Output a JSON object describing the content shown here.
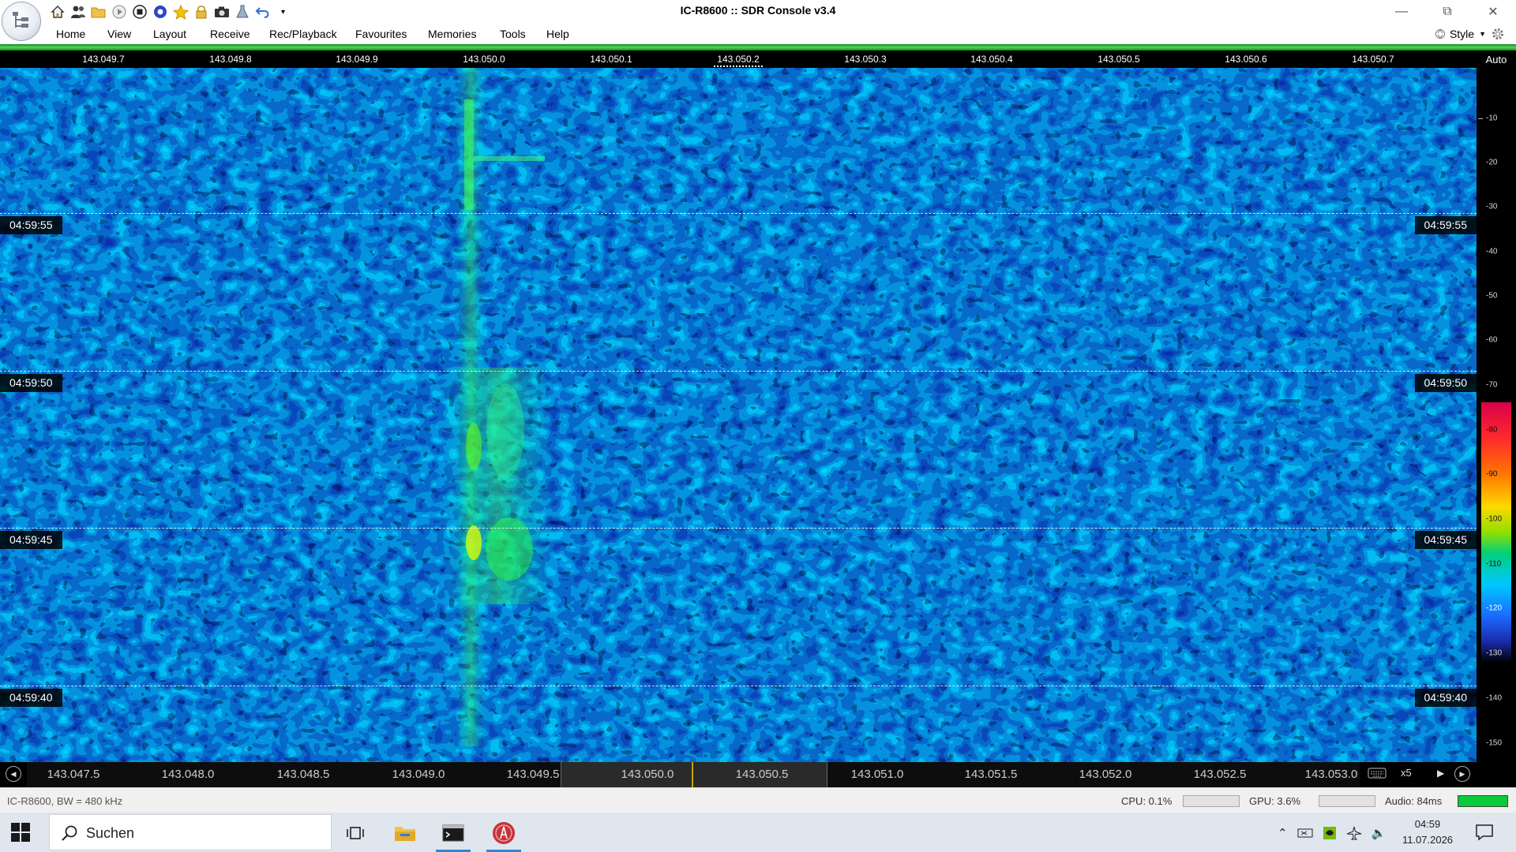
{
  "window": {
    "title": "IC-R8600 :: SDR Console v3.4",
    "controls": [
      "minimize",
      "restore",
      "close"
    ]
  },
  "quick_access": [
    "home-icon",
    "users-icon",
    "folder-icon",
    "play-icon",
    "stop-icon",
    "record-icon",
    "favourite-star-icon",
    "lock-icon",
    "camera-icon",
    "flask-icon",
    "undo-icon",
    "dropdown-icon"
  ],
  "menu": {
    "items": [
      "Home",
      "View",
      "Layout",
      "Receive",
      "Rec/Playback",
      "Favourites",
      "Memories",
      "Tools",
      "Help"
    ],
    "style_label": "Style"
  },
  "ruler_top": {
    "ticks": [
      "143.049.7",
      "143.049.8",
      "143.049.9",
      "143.050.0",
      "143.050.1",
      "143.050.2",
      "143.050.3",
      "143.050.4",
      "143.050.5",
      "143.050.6",
      "143.050.7"
    ],
    "auto_label": "Auto"
  },
  "waterfall": {
    "time_labels": [
      "04:59:55",
      "04:59:50",
      "04:59:45",
      "04:59:40"
    ]
  },
  "color_scale": {
    "labels": [
      "-10",
      "-20",
      "-30",
      "-40",
      "-50",
      "-60",
      "-70",
      "-80",
      "-90",
      "-100",
      "-110",
      "-120",
      "-130",
      "-140",
      "-150"
    ]
  },
  "bottom_ruler": {
    "ticks": [
      "143.047.5",
      "143.048.0",
      "143.048.5",
      "143.049.0",
      "143.049.5",
      "143.050.0",
      "143.050.5",
      "143.051.0",
      "143.051.5",
      "143.052.0",
      "143.052.5",
      "143.053.0"
    ],
    "zoom": "x5"
  },
  "status": {
    "device": "IC-R8600, BW = 480 kHz",
    "cpu": "CPU: 0.1%",
    "gpu": "GPU: 3.6%",
    "audio": "Audio: 84ms"
  },
  "taskbar": {
    "search_placeholder": "Suchen",
    "time": "04:59",
    "date": "11.07.2026"
  }
}
